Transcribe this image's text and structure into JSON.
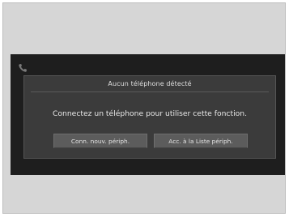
{
  "dialog": {
    "title": "Aucun téléphone détecté",
    "message": "Connectez un téléphone pour utiliser cette fonction.",
    "buttons": {
      "connect_new_label": "Conn. nouv. périph.",
      "device_list_label": "Acc. à la Liste périph."
    }
  },
  "status_bar": {
    "icon": "phone-icon"
  },
  "colors": {
    "screen_background": "#1e1e1e",
    "dialog_background": "#3b3b3b",
    "button_background": "#5c5c5c",
    "text": "#e8e8e8"
  }
}
